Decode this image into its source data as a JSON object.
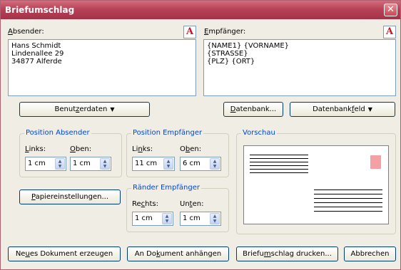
{
  "window": {
    "title": "Briefumschlag",
    "close_symbol": "✕"
  },
  "sender": {
    "label_first": "A",
    "label_rest": "bsender:",
    "text": "Hans Schmidt\nLindenallee 29\n34877 Alferde",
    "button": {
      "label_before": "Benut",
      "label_u": "z",
      "label_after": "erdaten",
      "arrow": "▼"
    }
  },
  "recipient": {
    "label_first": "E",
    "label_rest": "mpfänger:",
    "text": "{NAME1} {VORNAME}\n{STRASSE}\n{PLZ} {ORT}"
  },
  "format_button_glyph": "A",
  "datenbank_button": {
    "label_first": "D",
    "label_rest": "atenbank..."
  },
  "datenbankfeld_button": {
    "label_before": "Datenbank",
    "label_u": "f",
    "label_after": "eld",
    "arrow": "▼"
  },
  "position_sender": {
    "title": "Position Absender",
    "left_label_u": "L",
    "left_label_rest": "inks:",
    "top_label_u": "O",
    "top_label_rest": "ben:",
    "left_value": "1 cm",
    "top_value": "1 cm"
  },
  "position_recipient": {
    "title": "Position Empfänger",
    "left_label_before": "Li",
    "left_label_u": "n",
    "left_label_after": "ks:",
    "top_label_before": "O",
    "top_label_u": "b",
    "top_label_after": "en:",
    "left_value": "11 cm",
    "top_value": "6 cm"
  },
  "margins_recipient": {
    "title": "Ränder Empfänger",
    "right_label_before": "Re",
    "right_label_u": "c",
    "right_label_after": "hts:",
    "bottom_label_before": "Un",
    "bottom_label_u": "t",
    "bottom_label_after": "en:",
    "right_value": "1 cm",
    "bottom_value": "1 cm"
  },
  "preview": {
    "title": "Vorschau",
    "stamp_color": "#f4a1a6"
  },
  "paper_button": {
    "label_first": "P",
    "label_rest": "apiereinstellungen..."
  },
  "footer": {
    "new_doc": {
      "before": "Ne",
      "u": "u",
      "after": "es Dokument erzeugen"
    },
    "append": {
      "before": "An Do",
      "u": "k",
      "after": "ument anhängen"
    },
    "print": {
      "before": "Briefu",
      "u": "m",
      "after": "schlag drucken..."
    },
    "cancel": "Abbrechen"
  },
  "spin_arrows": {
    "up": "▲",
    "down": "▼"
  }
}
